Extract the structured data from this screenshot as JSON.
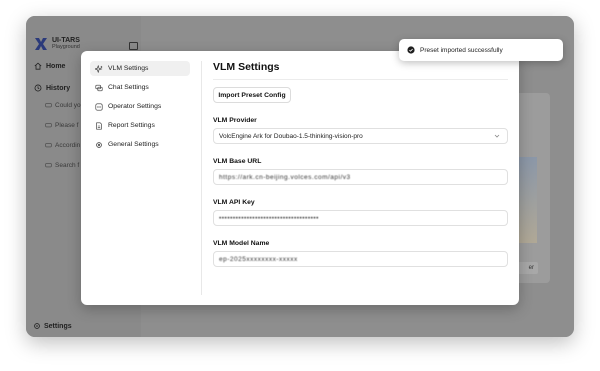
{
  "window": {
    "traffic_colors": [
      "#ff5f57",
      "#febc2e",
      "#28c840"
    ]
  },
  "sidebar": {
    "app_title": "UI-TARS",
    "app_subtitle": "Playground",
    "home_label": "Home",
    "history_label": "History",
    "history_items": [
      "Could yo",
      "Please f",
      "Accordin",
      "Search f"
    ],
    "settings_label": "Settings"
  },
  "background": {
    "button_label": "er"
  },
  "modal": {
    "nav": [
      {
        "label": "VLM Settings",
        "icon": "sparkles-icon",
        "active": true
      },
      {
        "label": "Chat Settings",
        "icon": "chat-icon",
        "active": false
      },
      {
        "label": "Operator Settings",
        "icon": "operator-icon",
        "active": false
      },
      {
        "label": "Report Settings",
        "icon": "report-icon",
        "active": false
      },
      {
        "label": "General Settings",
        "icon": "gear-icon",
        "active": false
      }
    ],
    "title": "VLM Settings",
    "import_button": "Import Preset Config",
    "provider_label": "VLM Provider",
    "provider_value": "VolcEngine Ark for Doubao-1.5-thinking-vision-pro",
    "base_url_label": "VLM Base URL",
    "base_url_value": "https://ark.cn-beijing.volces.com/api/v3",
    "api_key_label": "VLM API Key",
    "api_key_value": "••••••••••••••••••••••••••••••••••••",
    "model_name_label": "VLM Model Name",
    "model_name_value": "ep-2025xxxxxxxx-xxxxx"
  },
  "toast": {
    "message": "Preset imported successfully",
    "icon": "check-circle-icon"
  }
}
